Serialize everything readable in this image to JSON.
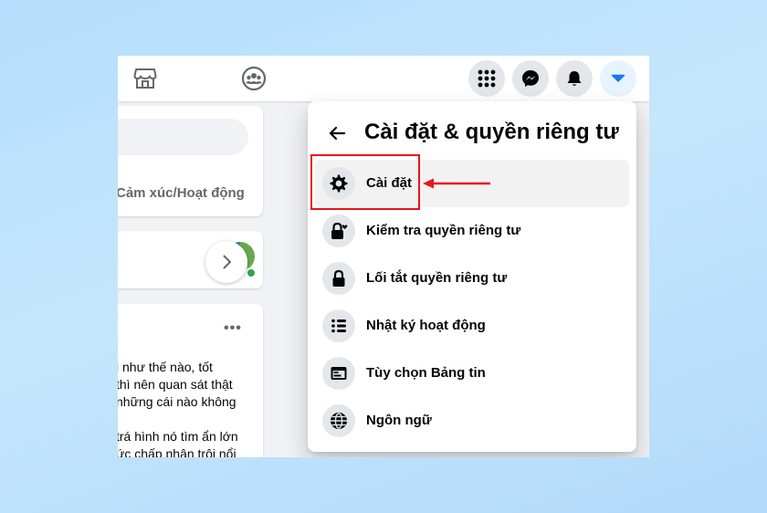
{
  "menu": {
    "title": "Cài đặt & quyền riêng tư",
    "items": [
      {
        "label": "Cài đặt",
        "icon": "gear-icon"
      },
      {
        "label": "Kiểm tra quyền riêng tư",
        "icon": "lock-heart-icon"
      },
      {
        "label": "Lối tắt quyền riêng tư",
        "icon": "lock-icon"
      },
      {
        "label": "Nhật ký hoạt động",
        "icon": "list-icon"
      },
      {
        "label": "Tùy chọn Bảng tin",
        "icon": "feed-icon"
      },
      {
        "label": "Ngôn ngữ",
        "icon": "globe-icon"
      }
    ]
  },
  "composer": {
    "feeling_label": "Cảm xúc/Hoạt động"
  },
  "post": {
    "lines": [
      "i như thế nào, tốt",
      "thì nên quan sát thật",
      "những cái nào không",
      "trá hình nó tìm ẩn lớn",
      "ức chấp nhận trôi nổi"
    ]
  },
  "colors": {
    "accent": "#1877f2",
    "annotation": "#e8141c"
  }
}
